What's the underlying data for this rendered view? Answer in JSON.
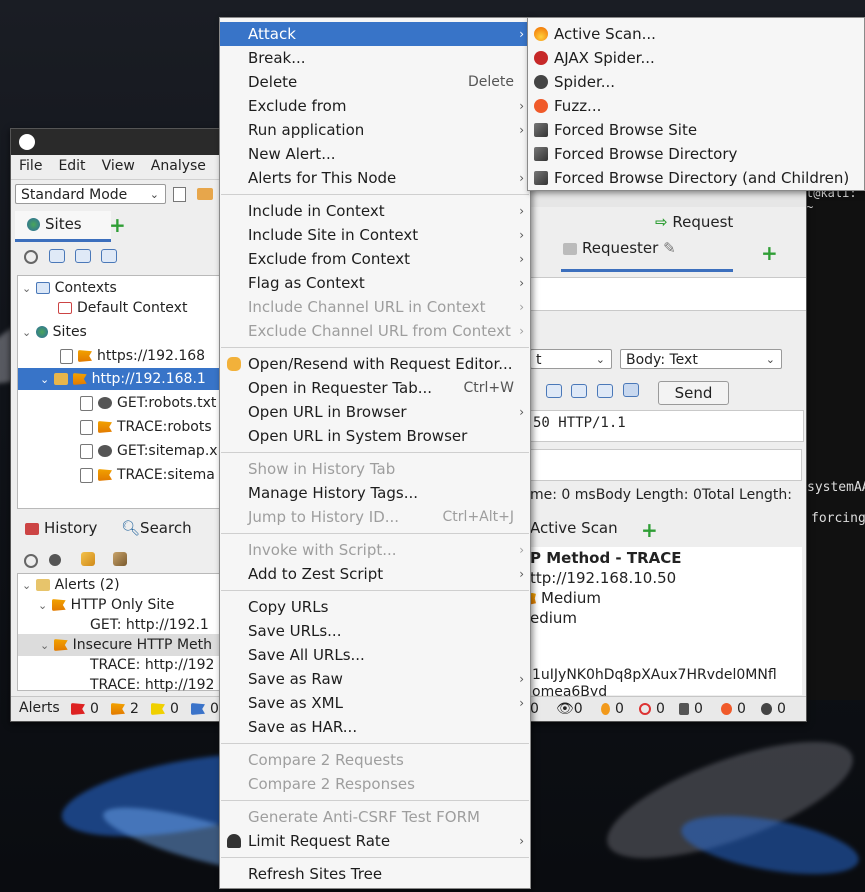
{
  "zap_window": {
    "menubar": [
      "File",
      "Edit",
      "View",
      "Analyse"
    ],
    "mode_select": "Standard Mode",
    "sites_tab": "Sites",
    "tree": {
      "contexts": "Contexts",
      "default_context": "Default Context",
      "sites": "Sites",
      "https_node": "https://192.168",
      "http_node": "http://192.168.1",
      "children": [
        "GET:robots.txt",
        "TRACE:robots",
        "GET:sitemap.x",
        "TRACE:sitema"
      ]
    },
    "bottom_tabs": {
      "history": "History",
      "search": "Search"
    },
    "alerts_tree": {
      "root": "Alerts (2)",
      "http_only": "HTTP Only Site",
      "http_only_child": "GET: http://192.1",
      "insecure": "Insecure HTTP Meth",
      "insecure_children": [
        "TRACE: http://192",
        "TRACE: http://192"
      ]
    },
    "status_alerts_label": "Alerts",
    "status_alert_counts": [
      "0",
      "2",
      "0",
      "0"
    ],
    "status_right_counts": [
      "0",
      "0",
      "0",
      "0",
      "0",
      "0",
      "0"
    ],
    "right": {
      "request_tab": "Request",
      "requester_tab": "Requester",
      "method_select": "t",
      "body_select": "Body: Text",
      "send_button": "Send",
      "request_line": "50 HTTP/1.1",
      "response_meta": "me: 0 msBody Length: 0Total Length:",
      "active_scan_tab": "Active Scan",
      "alert_title": "P Method - TRACE",
      "alert_url": "ttp://192.168.10.50",
      "alert_risk": "Medium",
      "alert_conf": "edium",
      "alert_hash": "1uIJyNK0hDq8pXAux7HRvdel0MNfl",
      "alert_hash2": "omea6Byd"
    },
    "terminal_fragments": [
      "t@kali: ~",
      "systemAA",
      "forcing"
    ]
  },
  "context_menu": {
    "items": [
      {
        "label": "Attack",
        "submenu": true,
        "selected": true
      },
      {
        "label": "Break..."
      },
      {
        "label": "Delete",
        "shortcut": "Delete"
      },
      {
        "label": "Exclude from",
        "submenu": true
      },
      {
        "label": "Run application",
        "submenu": true
      },
      {
        "label": "New Alert..."
      },
      {
        "label": "Alerts for This Node",
        "submenu": true
      },
      {
        "separator": true
      },
      {
        "label": "Include in Context",
        "submenu": true
      },
      {
        "label": "Include Site in Context",
        "submenu": true
      },
      {
        "label": "Exclude from Context",
        "submenu": true
      },
      {
        "label": "Flag as Context",
        "submenu": true
      },
      {
        "label": "Include Channel URL in Context",
        "submenu": true,
        "disabled": true
      },
      {
        "label": "Exclude Channel URL from Context",
        "submenu": true,
        "disabled": true
      },
      {
        "separator": true
      },
      {
        "label": "Open/Resend with Request Editor...",
        "icon": "hand-icon"
      },
      {
        "label": "Open in Requester Tab...",
        "shortcut": "Ctrl+W"
      },
      {
        "label": "Open URL in Browser",
        "submenu": true
      },
      {
        "label": "Open URL in System Browser"
      },
      {
        "separator": true
      },
      {
        "label": "Show in History Tab",
        "disabled": true
      },
      {
        "label": "Manage History Tags..."
      },
      {
        "label": "Jump to History ID...",
        "shortcut": "Ctrl+Alt+J",
        "disabled": true
      },
      {
        "separator": true
      },
      {
        "label": "Invoke with Script...",
        "submenu": true,
        "disabled": true
      },
      {
        "label": "Add to Zest Script",
        "submenu": true
      },
      {
        "separator": true
      },
      {
        "label": "Copy URLs"
      },
      {
        "label": "Save URLs..."
      },
      {
        "label": "Save All URLs..."
      },
      {
        "label": "Save as Raw",
        "submenu": true
      },
      {
        "label": "Save as XML",
        "submenu": true
      },
      {
        "label": "Save as HAR..."
      },
      {
        "separator": true
      },
      {
        "label": "Compare 2 Requests",
        "disabled": true
      },
      {
        "label": "Compare 2 Responses",
        "disabled": true
      },
      {
        "separator": true
      },
      {
        "label": "Generate Anti-CSRF Test FORM",
        "disabled": true
      },
      {
        "label": "Limit Request Rate",
        "submenu": true,
        "icon": "gauge-icon"
      },
      {
        "separator": true
      },
      {
        "label": "Refresh Sites Tree"
      }
    ]
  },
  "attack_submenu": {
    "items": [
      {
        "label": "Active Scan...",
        "icon": "flame-icon"
      },
      {
        "label": "AJAX Spider...",
        "icon": "red-spider-icon"
      },
      {
        "label": "Spider...",
        "icon": "spider-icon"
      },
      {
        "label": "Fuzz...",
        "icon": "fuzz-icon"
      },
      {
        "label": "Forced Browse Site",
        "icon": "hammer-icon"
      },
      {
        "label": "Forced Browse Directory",
        "icon": "hammer-icon"
      },
      {
        "label": "Forced Browse Directory (and Children)",
        "icon": "hammer-icon"
      }
    ]
  }
}
